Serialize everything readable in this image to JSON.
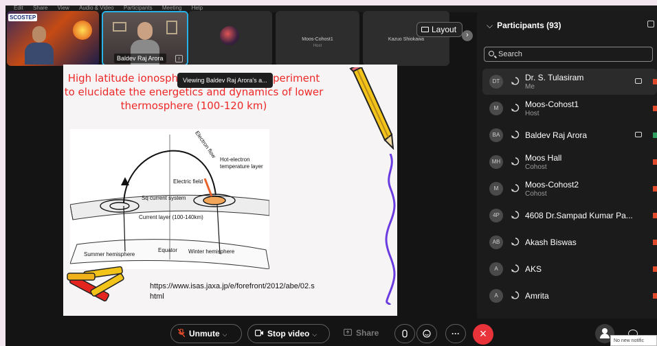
{
  "menubar": {
    "items": [
      "Edit",
      "Share",
      "View",
      "Audio & Video",
      "Participants",
      "Meeting",
      "Help"
    ]
  },
  "video_strip": {
    "tiles": [
      {
        "logo": "SCOSTEP"
      },
      {
        "name": "Baldev Raj Arora"
      },
      {
        "name": ""
      },
      {
        "name": "Moos-Cohost1",
        "role": "Host"
      },
      {
        "name": "Kazuo Shiokawa"
      }
    ],
    "layout_label": "Layout",
    "next_label": "›"
  },
  "slide": {
    "title": "High latitude ionospheric – magnetic experiment to elucidate the energetics and dynamics of lower thermosphere (100-120 km)",
    "toast": "Viewing Baldev Raj Arora's a...",
    "diagram_labels": {
      "electron_flow": "Electron flow",
      "hot_electron": "Hot-electron temperature layer",
      "electric_field": "Electric field",
      "sq_current": "Sq current system",
      "current_layer": "Current layer (100-140km)",
      "summer": "Summer hemisphere",
      "equator": "Equator",
      "winter": "Winter hemisphere"
    },
    "url": "https://www.isas.jaxa.jp/e/forefront/2012/abe/02.shtml"
  },
  "participants": {
    "title": "Participants (93)",
    "chevron": "⌵",
    "search_placeholder": "Search",
    "list": [
      {
        "initials": "DT",
        "name": "Dr. S. Tulasiram",
        "role": "Me",
        "camera": true,
        "mute_color": "#e04a2a",
        "me": true
      },
      {
        "initials": "M",
        "name": "Moos-Cohost1",
        "role": "Host",
        "camera": false,
        "mute_color": "#e04a2a"
      },
      {
        "initials": "BA",
        "name": "Baldev Raj Arora",
        "role": "",
        "camera": true,
        "mute_color": "#2f9e5f"
      },
      {
        "initials": "MH",
        "name": "Moos Hall",
        "role": "Cohost",
        "camera": false,
        "mute_color": "#e04a2a"
      },
      {
        "initials": "M",
        "name": "Moos-Cohost2",
        "role": "Cohost",
        "camera": false,
        "mute_color": "#e04a2a"
      },
      {
        "initials": "4P",
        "name": "4608 Dr.Sampad Kumar Pa...",
        "role": "",
        "camera": false,
        "mute_color": "#e04a2a"
      },
      {
        "initials": "AB",
        "name": "Akash Biswas",
        "role": "",
        "camera": false,
        "mute_color": "#e04a2a"
      },
      {
        "initials": "A",
        "name": "AKS",
        "role": "",
        "camera": false,
        "mute_color": "#e04a2a"
      },
      {
        "initials": "A",
        "name": "Amrita",
        "role": "",
        "camera": false,
        "mute_color": "#e04a2a"
      }
    ]
  },
  "controls": {
    "unmute": "Unmute",
    "stop_video": "Stop video",
    "share": "Share",
    "more": "···",
    "end": "×",
    "notification": "No new notific"
  },
  "colors": {
    "accent": "#27b3ea",
    "end_call": "#e8333a",
    "slide_title": "#ee2828"
  }
}
